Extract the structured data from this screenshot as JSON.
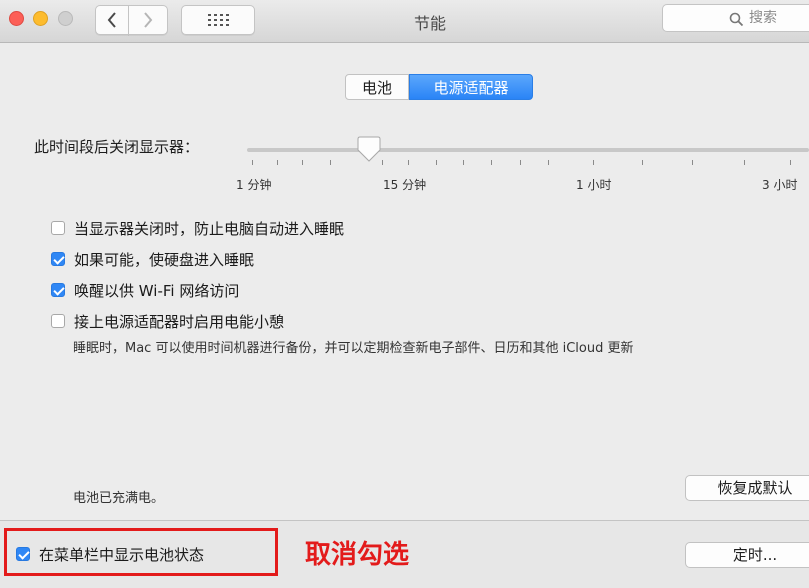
{
  "window": {
    "title": "节能"
  },
  "search": {
    "placeholder": "搜索"
  },
  "tabs": [
    {
      "label": "电池",
      "active": false
    },
    {
      "label": "电源适配器",
      "active": true
    }
  ],
  "display_sleep": {
    "label": "此时间段后关闭显示器：",
    "tick_labels": [
      "1 分钟",
      "15 分钟",
      "1 小时",
      "3 小时"
    ],
    "selected": "15 分钟"
  },
  "options": [
    {
      "label": "当显示器关闭时，防止电脑自动进入睡眠",
      "checked": false
    },
    {
      "label": "如果可能，使硬盘进入睡眠",
      "checked": true
    },
    {
      "label": "唤醒以供 Wi-Fi 网络访问",
      "checked": true
    },
    {
      "label": "接上电源适配器时启用电能小憩",
      "checked": false
    }
  ],
  "power_nap_note": "睡眠时，Mac 可以使用时间机器进行备份，并可以定期检查新电子部件、日历和其他 iCloud 更新",
  "battery_status": "电池已充满电。",
  "restore_button": "恢复成默认",
  "menubar_option": {
    "label": "在菜单栏中显示电池状态",
    "checked": true
  },
  "annotation": "取消勾选",
  "schedule_button": "定时...",
  "colors": {
    "accent": "#2f87f5",
    "annotation": "#e31b1b"
  }
}
